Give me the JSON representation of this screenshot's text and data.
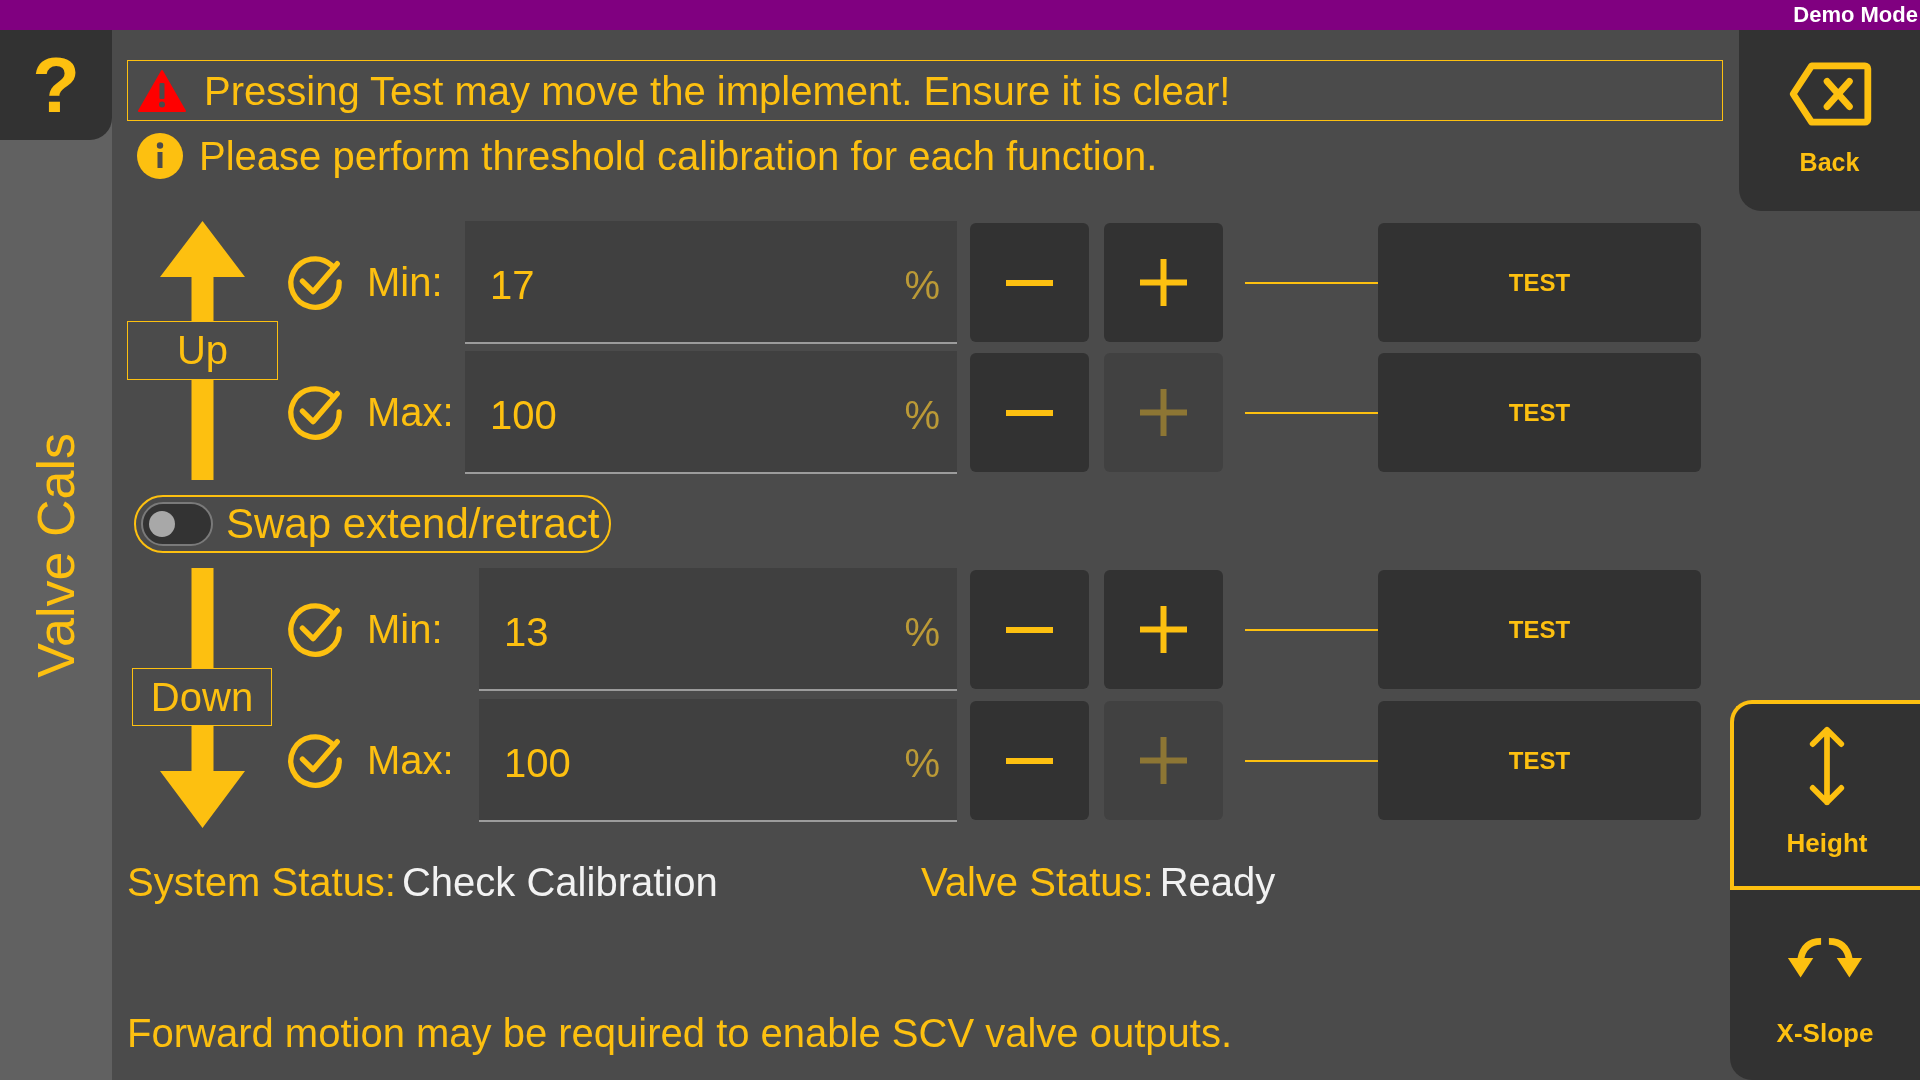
{
  "top_bar": {
    "mode": "Demo Mode"
  },
  "sidebar": {
    "help": "?",
    "title": "Valve Cals"
  },
  "warning": {
    "text": "Pressing Test may move the implement. Ensure it is clear!"
  },
  "info": {
    "text": "Please perform threshold calibration for each function."
  },
  "sections": [
    {
      "kind": "up",
      "label": "Up",
      "rows": [
        {
          "label": "Min:",
          "calibrated": true,
          "value": "17",
          "unit": "%",
          "decrease_disabled": false,
          "increase_disabled": false,
          "test": "TEST"
        },
        {
          "label": "Max:",
          "calibrated": true,
          "value": "100",
          "unit": "%",
          "decrease_disabled": false,
          "increase_disabled": true,
          "test": "TEST"
        }
      ]
    },
    {
      "kind": "down",
      "label": "Down",
      "rows": [
        {
          "label": "Min:",
          "calibrated": true,
          "value": "13",
          "unit": "%",
          "decrease_disabled": false,
          "increase_disabled": false,
          "test": "TEST"
        },
        {
          "label": "Max:",
          "calibrated": true,
          "value": "100",
          "unit": "%",
          "decrease_disabled": false,
          "increase_disabled": true,
          "test": "TEST"
        }
      ]
    }
  ],
  "swap": {
    "label": "Swap extend/retract",
    "on": false
  },
  "status": [
    {
      "label": "System Status:",
      "value": "Check Calibration"
    },
    {
      "label": "Valve Status:",
      "value": "Ready"
    }
  ],
  "footer": "Forward motion may be required to enable SCV valve outputs.",
  "back": {
    "label": "Back"
  },
  "nav": [
    {
      "label": "Height",
      "selected": true
    },
    {
      "label": "X-Slope",
      "selected": false
    }
  ]
}
